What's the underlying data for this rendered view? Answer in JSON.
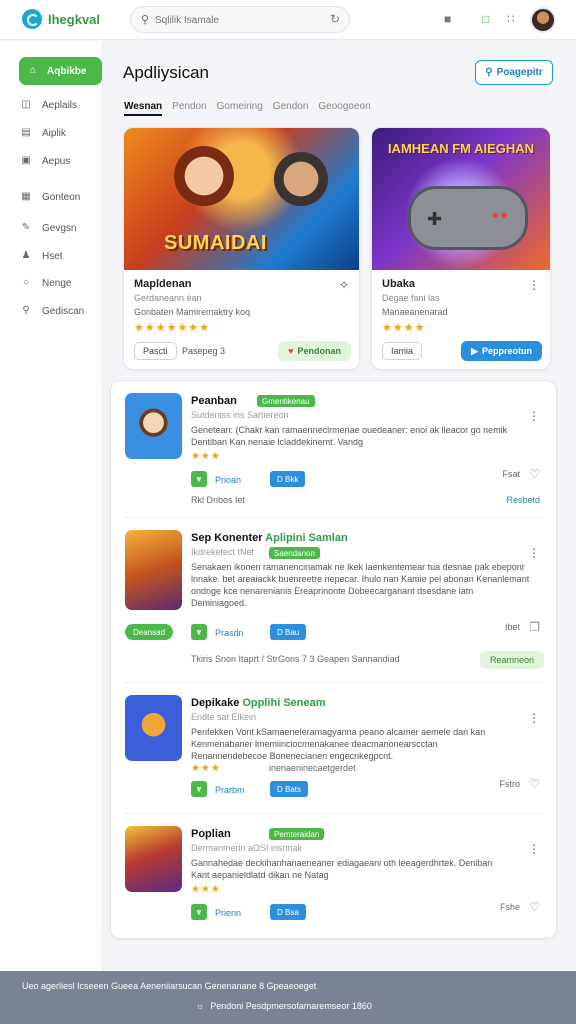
{
  "topbar": {
    "brand": "Ihegkval",
    "search_placeholder": "Sqlilik Isamale",
    "icons": [
      "search-icon",
      "reload-icon",
      "text-icon",
      "notification-icon",
      "grid-icon"
    ]
  },
  "sidebar": {
    "items": [
      {
        "label": "Aqbikbe",
        "icon": "home-icon"
      },
      {
        "label": "Aeplails",
        "icon": "apps-icon"
      },
      {
        "label": "Aiplik",
        "icon": "document-icon"
      },
      {
        "label": "Aepus",
        "icon": "box-icon"
      },
      {
        "label": "Gonteon",
        "icon": "calendar-icon"
      },
      {
        "label": "Gevgsn",
        "icon": "edit-icon"
      },
      {
        "label": "Hset",
        "icon": "people-icon"
      },
      {
        "label": "Nenge",
        "icon": "bell-icon"
      },
      {
        "label": "Gediscan",
        "icon": "search-icon"
      }
    ]
  },
  "main": {
    "title": "Apdliysican",
    "primary_button": "Poagepitr",
    "tabs": [
      "Wesnan",
      "Pendon",
      "Gomeiring",
      "Gendon",
      "Geoogoeon"
    ]
  },
  "featured": [
    {
      "banner_text": "SUMAIDAI",
      "title": "Mapldenan",
      "subtitle": "Gerdaneann éan",
      "desc": "Gonbaten Mamiremaktry koq",
      "stars": "★★★★★★★",
      "outline_button": "Pascti",
      "note": "Pasepeg 3",
      "pill": "Pendonan"
    },
    {
      "banner_text": "IAMHEAN FM AIEGHAN",
      "title": "Ubaka",
      "subtitle": "Degae fani las",
      "desc": "Manaeanenarad",
      "stars": "★★★★",
      "outline_button": "Iamia",
      "note": "",
      "pill": "Peppreotun"
    }
  ],
  "list": [
    {
      "title": "Peanban",
      "badge": "Gmentikenau",
      "subtitle": "Sutdeniss ins  Sartiereon",
      "desc": "Genetean: (Chakr kan ramaenneclrmenae ouedeaner: enoi ak lleacor go nemik Dentiban Kan nenaie lcladdekinemt. Vandg",
      "stars": "★★★",
      "link": "Prioan",
      "blue_button": "D Bkk",
      "count": "Fsat",
      "meta": "Rkl  Dnbos Iet",
      "meta_right": "Resbetd"
    },
    {
      "title": "Sep Konenter",
      "title_accent": "Aplipini Samlan",
      "badge": "Saendanon",
      "subtitle": "Ikdreketect tNet",
      "desc": "Senakaen ikonen ramanencinamak ne lkek laenkentemear tua desnae pak ebeponr lnnake. bet areaiackk buenreetre nepecar. Ihulo nan Kamie pel abonan Kenanlemant ondnge kce nenarenianis Ereaprinonte Dobeecarganant dsesdane latn Deminiagoed.",
      "green_button": "Deansad",
      "link": "Prasdn",
      "blue_button": "D Bau",
      "count": "Ibet",
      "meta": "Tkiris  Snon  Itaprt / StrGons 7 3  Geapen Sannandiad",
      "soft_pill": "Reamneon"
    },
    {
      "title": "Depikake",
      "title_accent": "Opplihi Seneam",
      "badge": "",
      "subtitle": "Endte sat Elkein",
      "desc": "Penfekken Vont kSamaeneleramagyanna peano alcamer aemele dan kan Kenmenabaner lmemiinciocmenakanee deacmanonearscctan Renannendebecoe Bonenecianen engecnkegpcnt.",
      "stars": "★★★",
      "subtitle2": "inenaeninecaetgerdet",
      "link": "Prarbm",
      "blue_button": "D Bats",
      "count": "Fstro"
    },
    {
      "title": "Poplian",
      "badge": "Pemteraidan",
      "subtitle": "Dermanmerin aOSI insnnak",
      "desc": "Gannahedae deckihanhanaeneaner ediagaeani oth leeagerdhrtek. Deniban Kant aepanieldlatd dikan ne Natag",
      "stars": "★★★",
      "link": "Prienn",
      "blue_button": "D Bsa",
      "count": "Fshe"
    }
  ],
  "footer": {
    "line1": "Ueo agerliesl Icseeen Gueea Aeneniiarsucan Genenanane 8 Gpeaeoeget",
    "line2": "Pendoni Pesdpmersofamaremseor 1860"
  },
  "colors": {
    "accent_green": "#4cb84a",
    "accent_blue": "#2b8fdc",
    "star": "#f2a20b"
  }
}
